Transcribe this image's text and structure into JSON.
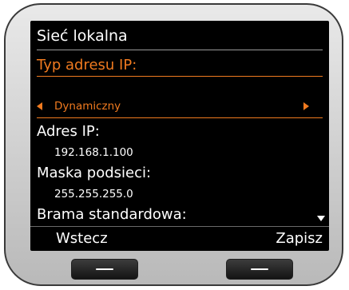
{
  "screen": {
    "title": "Sieć lokalna"
  },
  "fields": {
    "ip_type": {
      "label": "Typ adresu IP:",
      "value": "Dynamiczny"
    },
    "ip_address": {
      "label": "Adres IP:",
      "value": "192.168.1.100"
    },
    "subnet_mask": {
      "label": "Maska podsieci:",
      "value": "255.255.255.0"
    },
    "default_gateway": {
      "label": "Brama standardowa:"
    }
  },
  "softkeys": {
    "left": "Wstecz",
    "right": "Zapisz"
  },
  "colors": {
    "accent": "#f07a1f",
    "screen_background": "#000000",
    "text": "#ffffff"
  },
  "icons": {
    "prev_option": "triangle-left-icon",
    "next_option": "triangle-right-icon",
    "scroll_down": "triangle-down-icon"
  }
}
